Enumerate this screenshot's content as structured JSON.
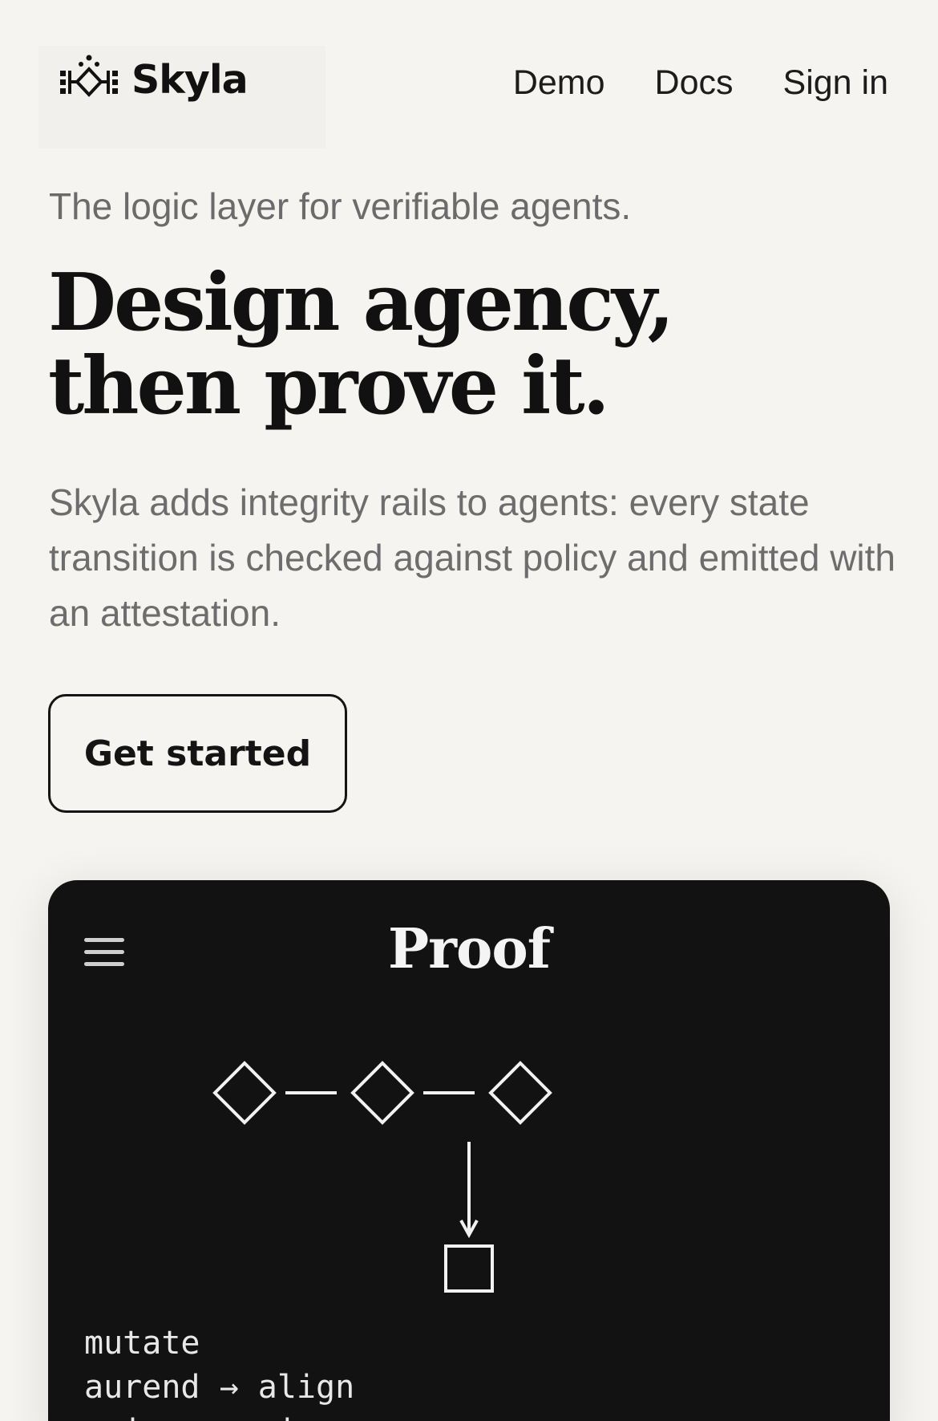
{
  "brand": {
    "name": "Skyla"
  },
  "nav": {
    "items": [
      "Demo",
      "Docs",
      "Sign in"
    ]
  },
  "hero": {
    "tagline": "The logic layer for verifiable agents.",
    "headline_line1": "Design agency,",
    "headline_line2": "then prove it.",
    "lede": "Skyla adds integrity rails to agents: every state transition is checked against policy and emitted with an attestation.",
    "cta_label": "Get started"
  },
  "card": {
    "title": "Proof",
    "code_lines": [
      "mutate",
      "aurend → align",
      "axiom → arise"
    ]
  },
  "colors": {
    "page_bg": "#f5f4f0",
    "card_bg": "#121212",
    "text_dark": "#111111",
    "text_muted": "#6d6d6d"
  }
}
